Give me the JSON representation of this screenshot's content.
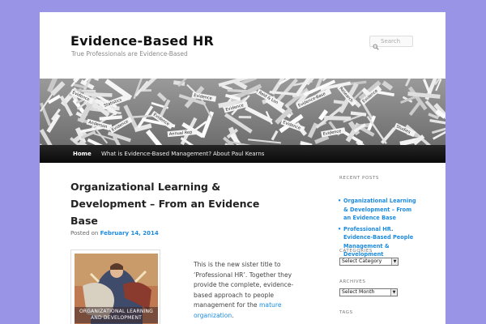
{
  "site": {
    "title": "Evidence-Based HR",
    "description": "True Professionals are Evidence-Based"
  },
  "search": {
    "placeholder": "Search",
    "icon": "search-icon"
  },
  "nav": {
    "items": [
      {
        "label": "Home",
        "active": true
      },
      {
        "label": "What is Evidence-Based Management?",
        "active": false
      },
      {
        "label": "About Paul Kearns",
        "active": false
      }
    ]
  },
  "banner": {
    "fragments": [
      "Evidence",
      "Evidence",
      "Evidence",
      "Evidence",
      "Evidence",
      "Evidence",
      "Evidence",
      "Evidence",
      "Statistics",
      "Anderson",
      "Reid & Lon",
      "Research",
      "Annual Rep",
      "Studies",
      "Evidence-Base"
    ]
  },
  "post": {
    "title": "Organizational Learning & Development – From an Evidence Base",
    "meta_prefix": "Posted on",
    "date": "February 14, 2014",
    "body_text": "This is the new sister title to ‘Professional HR’. Together they provide the complete, evidence-based approach to people management for the",
    "body_link": "mature organization",
    "body_end": ".",
    "thumbnail_caption": "ORGANIZATIONAL LEARNING AND DEVELOPMENT"
  },
  "sidebar": {
    "recent_title": "RECENT POSTS",
    "recent": [
      "Organizational Learning & Development – From an Evidence Base",
      "Professional HR. Evidence-Based People Management & Development"
    ],
    "categories_title": "CATEGORIES",
    "categories_select": "Select Category",
    "archives_title": "ARCHIVES",
    "archives_select": "Select Month",
    "tags_title": "TAGS"
  },
  "colors": {
    "background": "#9a94e6",
    "link": "#1b8be0",
    "nav_bg": "#111111"
  }
}
